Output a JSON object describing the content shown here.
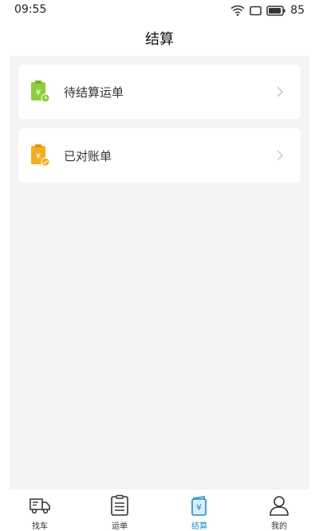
{
  "status_bar": {
    "time": "09:55",
    "battery": "85"
  },
  "header": {
    "title": "结算"
  },
  "cards": [
    {
      "label": "待结算运单",
      "icon": "green-clipboard-yen-clock-icon",
      "color": "#8ccf3a"
    },
    {
      "label": "已对账单",
      "icon": "orange-clipboard-yen-check-icon",
      "color": "#f6ad1b"
    }
  ],
  "tabs": [
    {
      "label": "找车",
      "icon": "truck-icon",
      "active": false
    },
    {
      "label": "运单",
      "icon": "clipboard-list-icon",
      "active": false
    },
    {
      "label": "结算",
      "icon": "yen-book-icon",
      "active": true
    },
    {
      "label": "我的",
      "icon": "user-icon",
      "active": false
    }
  ],
  "colors": {
    "active_tab": "#1c8ce0",
    "background": "#f4f4f4",
    "text": "#333333"
  }
}
